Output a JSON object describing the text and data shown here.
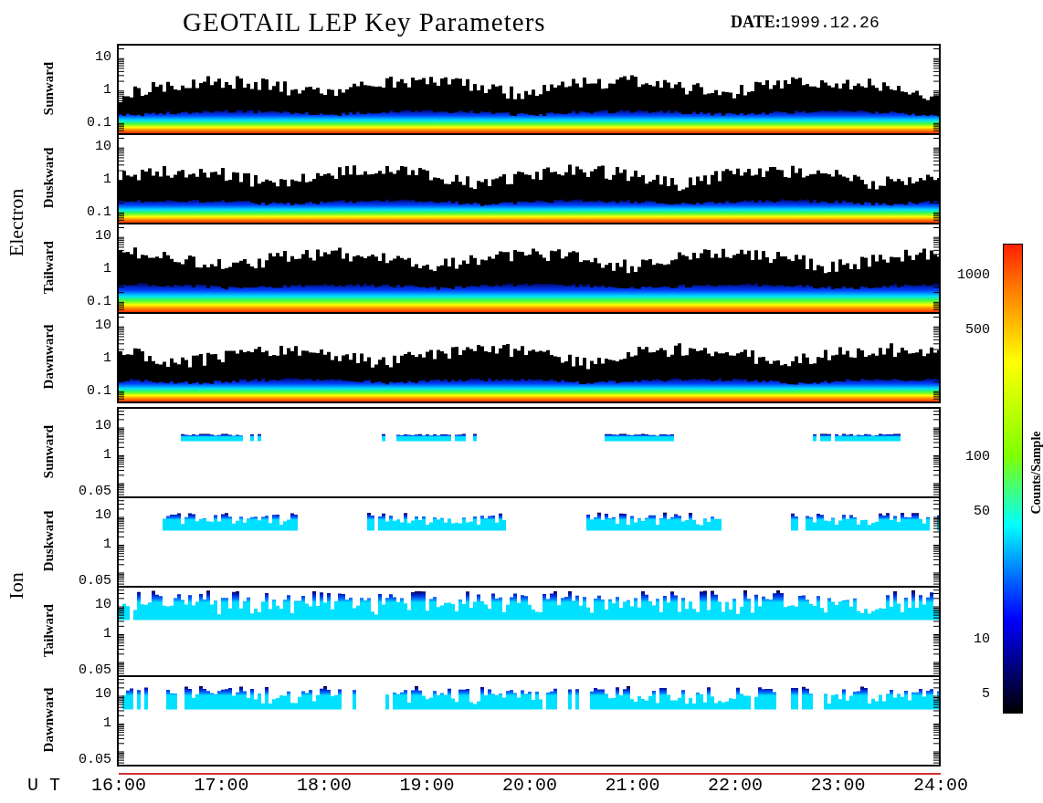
{
  "title": "GEOTAIL LEP Key Parameters",
  "date": "**DATE:**1999.12.26",
  "groups": [
    {
      "name": "Electron",
      "kind": "electron",
      "panels": [
        {
          "label": "Sunward",
          "yticks": [
            "10",
            "1",
            "0.1"
          ]
        },
        {
          "label": "Duskward",
          "yticks": [
            "10",
            "1",
            "0.1"
          ]
        },
        {
          "label": "Tailward",
          "yticks": [
            "10",
            "1",
            "0.1"
          ]
        },
        {
          "label": "Dawnward",
          "yticks": [
            "10",
            "1",
            "0.1"
          ]
        }
      ]
    },
    {
      "name": "Ion",
      "kind": "ion",
      "panels": [
        {
          "label": "Sunward",
          "yticks": [
            "10",
            "1",
            "0.05"
          ]
        },
        {
          "label": "Duskward",
          "yticks": [
            "10",
            "1",
            "0.05"
          ]
        },
        {
          "label": "Tailward",
          "yticks": [
            "10",
            "1",
            "0.05"
          ]
        },
        {
          "label": "Dawnward",
          "yticks": [
            "10",
            "1",
            "0.05"
          ]
        }
      ]
    }
  ],
  "time_axis": {
    "label": "U T",
    "ticks": [
      "16:00",
      "17:00",
      "18:00",
      "19:00",
      "20:00",
      "21:00",
      "22:00",
      "23:00",
      "24:00"
    ]
  },
  "colorbar": {
    "label": "Counts/Sample",
    "ticks": [
      "1000",
      "500",
      "100",
      "50",
      "10",
      "5"
    ]
  }
}
